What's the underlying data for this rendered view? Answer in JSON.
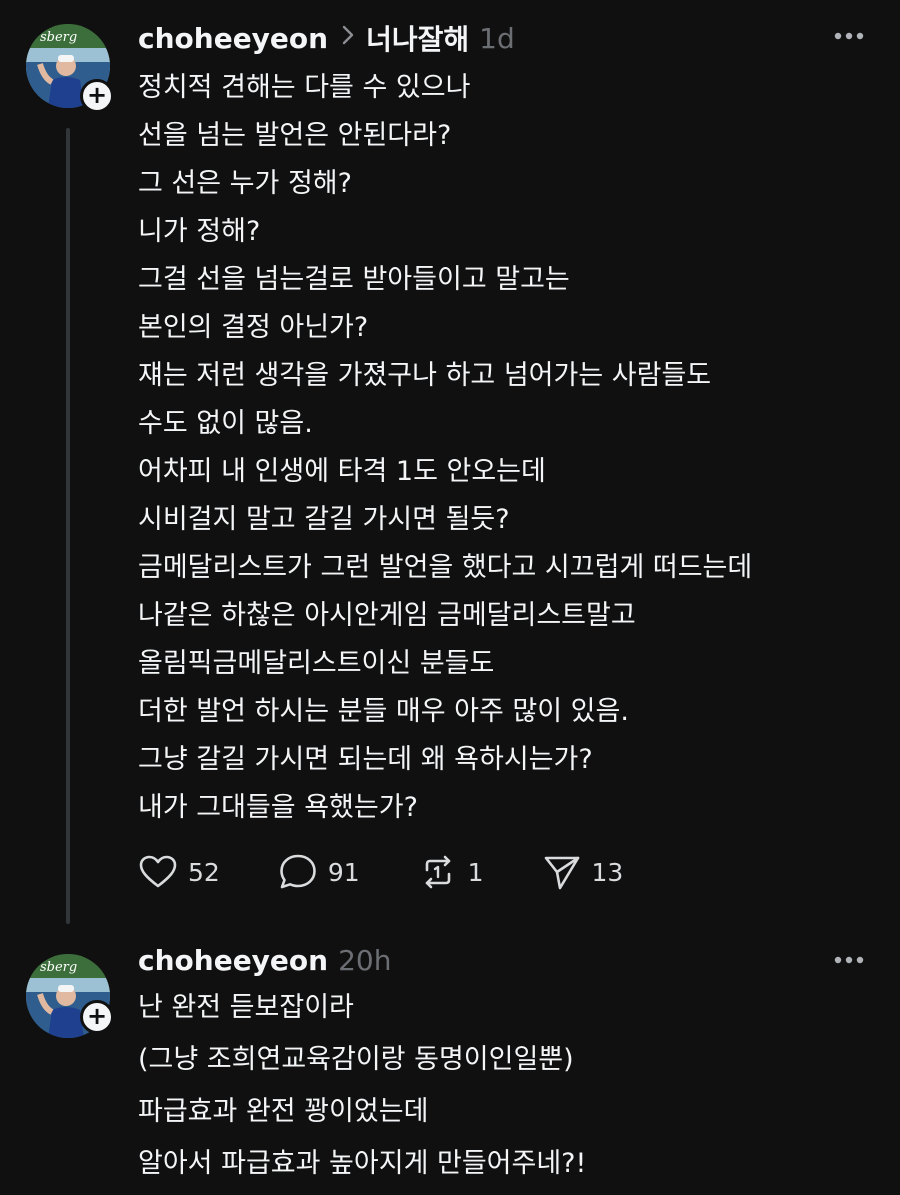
{
  "posts": [
    {
      "username": "choheeyeon",
      "reply_to": "너나잘해",
      "time": "1d",
      "lines": [
        "정치적 견해는 다를 수 있으나",
        "선을 넘는 발언은 안된다라?",
        "그 선은 누가 정해?",
        "니가 정해?",
        "그걸 선을 넘는걸로 받아들이고 말고는",
        "본인의 결정 아닌가?",
        "쟤는 저런 생각을 가졌구나 하고 넘어가는 사람들도",
        "수도 없이 많음.",
        "어차피 내 인생에 타격 1도 안오는데",
        "시비걸지 말고 갈길 가시면 될듯?",
        "금메달리스트가 그런 발언을 했다고 시끄럽게 떠드는데",
        "나같은 하찮은 아시안게임 금메달리스트말고",
        "올림픽금메달리스트이신 분들도",
        "더한 발언 하시는 분들 매우 아주 많이 있음.",
        "그냥 갈길 가시면 되는데 왜 욕하시는가?",
        "내가 그대들을 욕했는가?"
      ],
      "actions": {
        "likes": "52",
        "comments": "91",
        "reposts": "1",
        "shares": "13"
      }
    },
    {
      "username": "choheeyeon",
      "time": "20h",
      "lines": [
        "난 완전 듣보잡이라",
        "(그냥 조희연교육감이랑 동명이인일뿐)",
        "파급효과 완전 꽝이었는데",
        "알아서 파급효과 높아지게 만들어주네?!"
      ]
    }
  ],
  "icons": {
    "like": "heart-icon",
    "comment": "speech-bubble-icon",
    "repost": "repost-icon",
    "share": "send-icon",
    "more": "more-dots-icon",
    "follow": "plus-icon"
  },
  "colors": {
    "background": "#101010",
    "text": "#f3f5f7",
    "muted": "#6b6e72"
  }
}
